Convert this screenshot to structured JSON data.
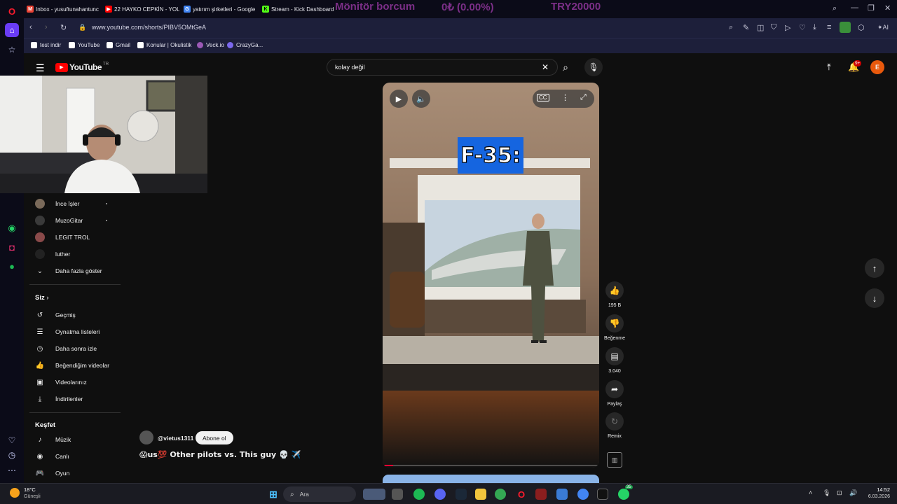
{
  "browser": {
    "tabs": [
      {
        "label": "Inbox - yusuftunahantunc",
        "fav": "M",
        "color": "#ea4335"
      },
      {
        "label": "22 HAYKO CEPKİN - YOL",
        "fav": "▶",
        "color": "#ff0000"
      },
      {
        "label": "yatırım şirketleri - Google",
        "fav": "G",
        "color": "#4285f4"
      },
      {
        "label": "Stream - Kick Dashboard",
        "fav": "K",
        "color": "#53fc18"
      }
    ],
    "overlay": {
      "line1": "Mönitör borcum",
      "line2": "0₺ (0.00%)",
      "line3": "TRY20000"
    },
    "url": "www.youtube.com/shorts/PIBV5OMtGeA",
    "ai_label": "AI",
    "bookmarks": [
      {
        "label": "test indir",
        "color": "#ffffff"
      },
      {
        "label": "YouTube",
        "color": "#ffffff"
      },
      {
        "label": "Gmail",
        "color": "#ffffff"
      },
      {
        "label": "Konular | Okulistik",
        "color": "#ffffff"
      },
      {
        "label": "Veck.io",
        "color": "#9b59b6"
      },
      {
        "label": "CrazyGa...",
        "color": "#7b68ee"
      }
    ]
  },
  "youtube": {
    "logo_text": "YouTube",
    "country": "TR",
    "search_query": "kolay değil",
    "notification_badge": "9+",
    "avatar_letter": "E",
    "subscriptions": [
      "İnce İşler",
      "MuzoGitar",
      "LEGIT TROL",
      "luther"
    ],
    "show_more": "Daha fazla göster",
    "you_section": "Siz",
    "you_items": [
      "Geçmiş",
      "Oynatma listeleri",
      "Daha sonra izle",
      "Beğendiğim videolar",
      "Videolarınız",
      "İndirilenler"
    ],
    "explore_section": "Keşfet",
    "explore_items": [
      "Müzik",
      "Canlı",
      "Oyun"
    ],
    "video": {
      "caption": "F-35:",
      "channel": "@vietus1311",
      "subscribe": "Abone ol",
      "title": "😱us💯 Other pilots vs. This guy 💀 ✈️",
      "progress": 0.05
    },
    "actions": {
      "likes": "195 B",
      "dislike": "Beğenme",
      "comments": "3.040",
      "share": "Paylaş",
      "remix": "Remix"
    }
  },
  "taskbar": {
    "weather_temp": "18°C",
    "weather_desc": "Güneşli",
    "search_placeholder": "Ara",
    "time": "14:52",
    "date": "6.03.2026",
    "whatsapp_badge": "35"
  }
}
